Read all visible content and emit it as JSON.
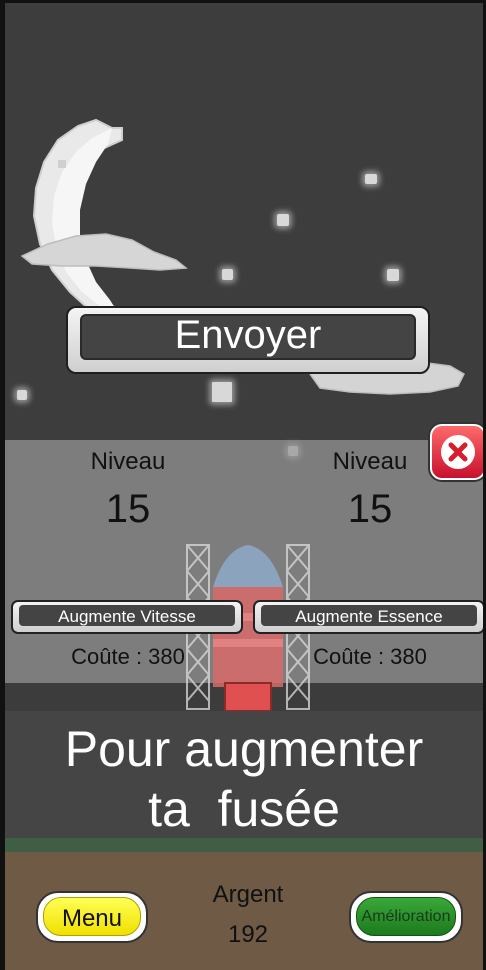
{
  "main_button": {
    "label": "Envoyer"
  },
  "upgrades": {
    "left": {
      "level_label": "Niveau",
      "level": "15",
      "button_label": "Augmente Vitesse",
      "cost": "Coûte : 380"
    },
    "right": {
      "level_label": "Niveau",
      "level": "15",
      "button_label": "Augmente Essence",
      "cost": "Coûte : 380"
    }
  },
  "banner": {
    "line1": "Pour augmenter",
    "line2": "ta  fusée"
  },
  "footer": {
    "menu_label": "Menu",
    "money_label": "Argent",
    "money_value": "192",
    "upgrade_label": "Amélioration"
  },
  "icons": {
    "close": "close-icon"
  },
  "colors": {
    "menu": "#f0e000",
    "upgrade": "#2a8f2a",
    "close": "#d81c2c",
    "ground": "#6e5a45",
    "grass": "#3f5e43"
  }
}
